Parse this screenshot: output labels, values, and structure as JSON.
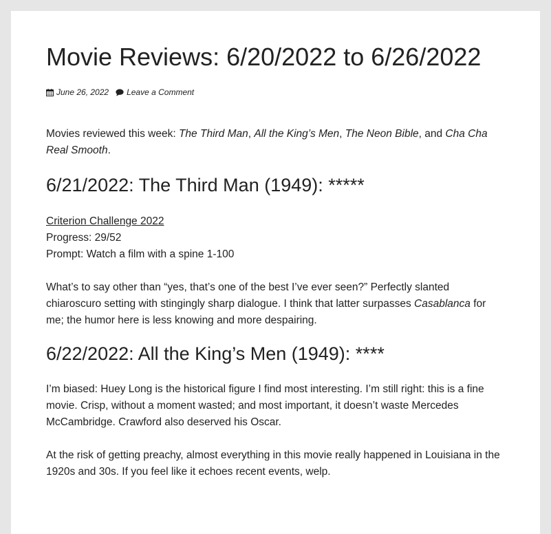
{
  "post": {
    "title": "Movie Reviews: 6/20/2022 to 6/26/2022",
    "date": "June 26, 2022",
    "comment_link": "Leave a Comment",
    "icons": {
      "date": "calendar-icon",
      "comment": "speech-bubble-icon"
    }
  },
  "intro": {
    "prefix": "Movies reviewed this week: ",
    "film1": "The Third Man",
    "sep1": ", ",
    "film2": "All the King’s Men",
    "sep2": ", ",
    "film3": "The Neon Bible",
    "sep3": ", and ",
    "film4": "Cha Cha Real Smooth",
    "suffix": "."
  },
  "review1": {
    "heading": "6/21/2022: The Third Man (1949): *****",
    "challenge_link": "Criterion Challenge 2022",
    "progress": "Progress: 29/52",
    "prompt": "Prompt: Watch a film with a spine 1-100",
    "body_before": "What’s to say other than “yes, that’s one of the best I’ve ever seen?” Perfectly slanted chiaroscuro setting with stingingly sharp dialogue. I think that latter surpasses ",
    "body_em": "Casablanca",
    "body_after": " for me; the humor here is less knowing and more despairing."
  },
  "review2": {
    "heading": "6/22/2022: All the King’s Men (1949): ****",
    "para1": "I’m biased: Huey Long is the historical figure I find most interesting. I’m still right: this is a fine movie. Crisp, without a moment wasted; and most important, it doesn’t waste Mercedes McCambridge. Crawford also deserved his Oscar.",
    "para2": "At the risk of getting preachy, almost everything in this movie really happened in Louisiana in the 1920s and 30s. If you feel like it echoes recent events, welp."
  },
  "colors": {
    "page_background": "#e6e6e6",
    "card_background": "#ffffff",
    "text": "#222222"
  }
}
